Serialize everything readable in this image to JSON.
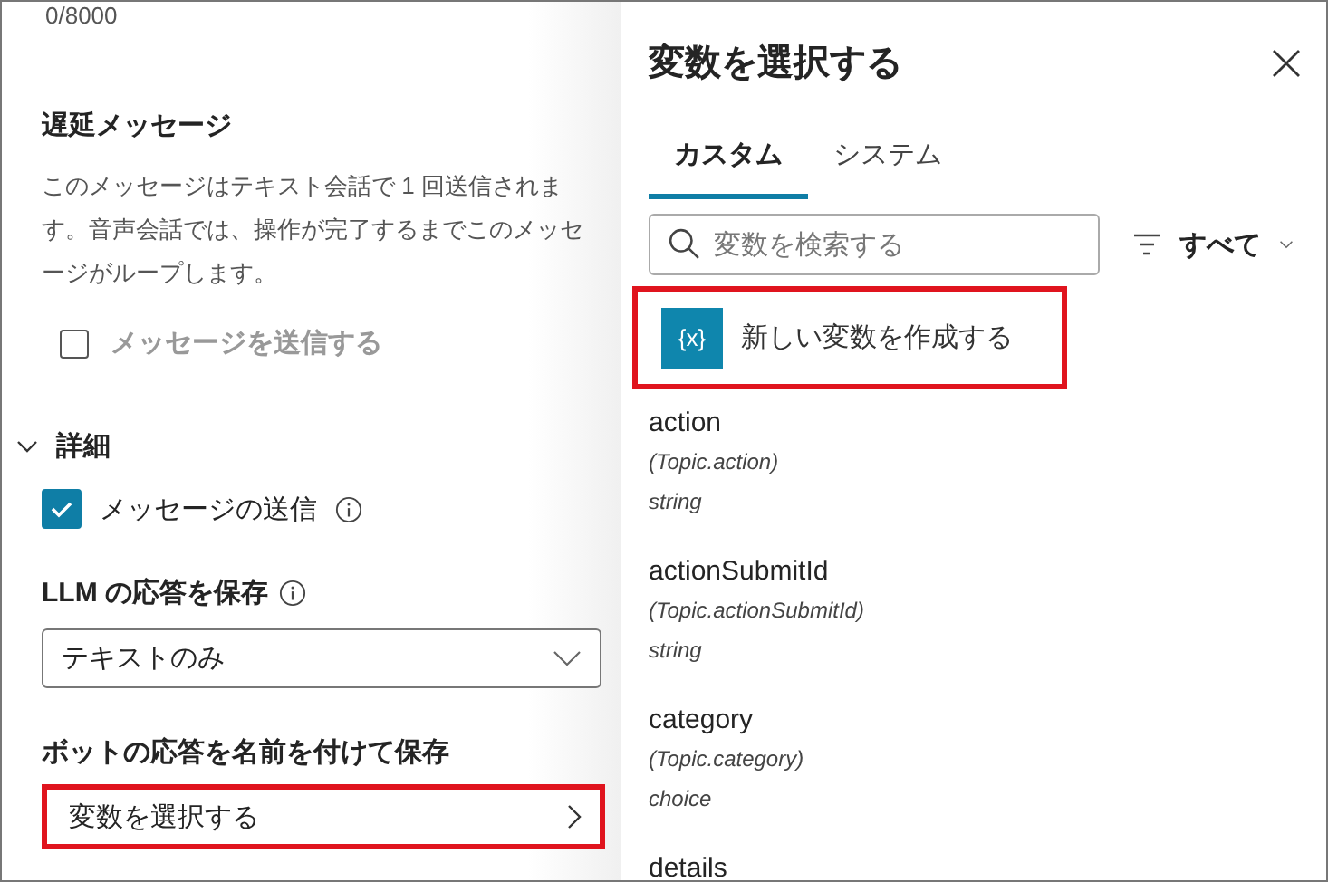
{
  "character_count": "0/8000",
  "delay_section": {
    "title": "遅延メッセージ",
    "description": "このメッセージはテキスト会話で 1 回送信されます。音声会話では、操作が完了するまでこのメッセージがループします。",
    "send_checkbox": {
      "label": "メッセージを送信する",
      "checked": false,
      "disabled": true
    }
  },
  "details": {
    "label": "詳細",
    "expanded": true,
    "send_message": {
      "label": "メッセージの送信",
      "checked": true
    },
    "save_llm": {
      "label": "LLM の応答を保存",
      "value": "テキストのみ"
    },
    "save_bot": {
      "label": "ボットの応答を名前を付けて保存",
      "button": "変数を選択する",
      "highlighted": true
    }
  },
  "panel": {
    "title": "変数を選択する",
    "tabs": [
      {
        "label": "カスタム",
        "selected": true
      },
      {
        "label": "システム",
        "selected": false
      }
    ],
    "search": {
      "placeholder": "変数を検索する"
    },
    "filter": "すべて",
    "create": {
      "icon_text": "{x}",
      "label": "新しい変数を作成する",
      "highlighted": true
    },
    "variables": [
      {
        "name": "action",
        "scope": "(Topic.action)",
        "type": "string"
      },
      {
        "name": "actionSubmitId",
        "scope": "(Topic.actionSubmitId)",
        "type": "string"
      },
      {
        "name": "category",
        "scope": "(Topic.category)",
        "type": "choice"
      },
      {
        "name": "details"
      }
    ]
  }
}
